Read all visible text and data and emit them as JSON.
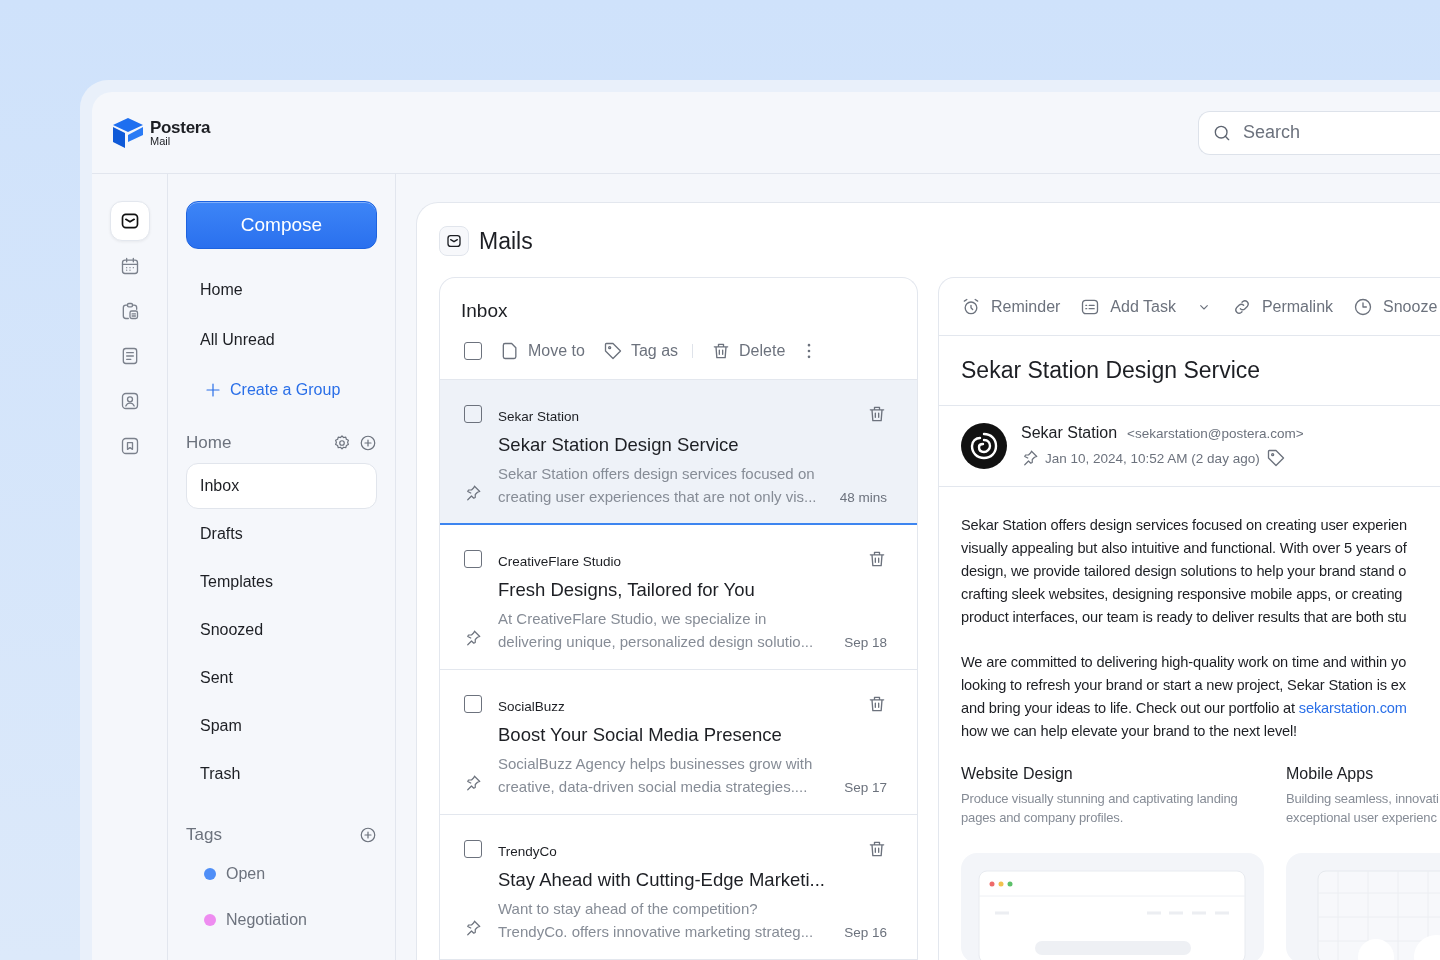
{
  "app": {
    "name": "Postera",
    "subtitle": "Mail"
  },
  "search": {
    "placeholder": "Search"
  },
  "rail": [
    {
      "selected": true
    },
    {
      "selected": false
    },
    {
      "selected": false
    },
    {
      "selected": false
    },
    {
      "selected": false
    },
    {
      "selected": false
    }
  ],
  "compose": "Compose",
  "nav": [
    {
      "label": "Home",
      "kind": "link"
    },
    {
      "label": "All Unread",
      "kind": "link"
    },
    {
      "label": "Create a Group",
      "kind": "action"
    }
  ],
  "folders_section": {
    "title": "Home",
    "items": [
      {
        "label": "Inbox",
        "selected": true
      },
      {
        "label": "Drafts",
        "selected": false
      },
      {
        "label": "Templates",
        "selected": false
      },
      {
        "label": "Snoozed",
        "selected": false
      },
      {
        "label": "Sent",
        "selected": false
      },
      {
        "label": "Spam",
        "selected": false
      },
      {
        "label": "Trash",
        "selected": false
      }
    ]
  },
  "tags_section": {
    "title": "Tags",
    "items": [
      {
        "label": "Open",
        "color": "#4f8ef7"
      },
      {
        "label": "Negotiation",
        "color": "#ee8cf0"
      }
    ]
  },
  "main": {
    "title": "Mails"
  },
  "inbox": {
    "title": "Inbox",
    "checked": false,
    "actions": [
      {
        "label": "Move to",
        "kind": "move"
      },
      {
        "label": "Tag as",
        "kind": "tag"
      },
      {
        "label": "Delete",
        "kind": "delete"
      }
    ],
    "mails": [
      {
        "sender": "Sekar Station",
        "subject": "Sekar Station Design Service",
        "preview": "Sekar Station offers design services focused on creating user experiences that are not only vis...",
        "time": "48 mins",
        "selected": true,
        "checked": false
      },
      {
        "sender": "CreativeFlare Studio",
        "subject": "Fresh Designs, Tailored for You",
        "preview": "At CreativeFlare Studio, we specialize in delivering unique, personalized design solutio...",
        "time": "Sep 18",
        "selected": false,
        "checked": false
      },
      {
        "sender": "SocialBuzz",
        "subject": "Boost Your Social Media Presence",
        "preview": "SocialBuzz Agency helps businesses grow with creative, data-driven social media strategies....",
        "time": "Sep 17",
        "selected": false,
        "checked": false
      },
      {
        "sender": "TrendyCo",
        "subject": "Stay Ahead with Cutting-Edge Marketi...",
        "preview": "Want to stay ahead of the competition? TrendyCo. offers innovative marketing strateg...",
        "time": "Sep 16",
        "selected": false,
        "checked": false
      }
    ]
  },
  "detail": {
    "actions": [
      {
        "label": "Reminder",
        "kind": "reminder"
      },
      {
        "label": "Add Task",
        "kind": "task"
      },
      {
        "label": "Permalink",
        "kind": "link"
      },
      {
        "label": "Snooze",
        "kind": "snooze"
      }
    ],
    "title": "Sekar Station Design Service",
    "sender": {
      "name": "Sekar Station",
      "email": "<sekarstation@postera.com>",
      "date": "Jan 10, 2024, 10:52 AM (2 day ago)"
    },
    "paragraphs": [
      [
        {
          "text": "Sekar Station offers design services focused on creating user experien"
        },
        {
          "text": "visually appealing but also intuitive and functional. With over 5 years of"
        },
        {
          "text": "design, we provide tailored design solutions to help your brand stand o"
        },
        {
          "text": "crafting sleek websites, designing responsive mobile apps, or creating"
        },
        {
          "text": "product interfaces, our team is ready to deliver results that are both stu"
        }
      ],
      [
        {
          "text": "We are committed to delivering high-quality work on time and within yo"
        },
        {
          "text": "looking to refresh your brand or start a new project, Sekar Station is ex"
        },
        {
          "text": "and bring your ideas to life. Check out our portfolio at ",
          "link": "sekarstation.com"
        },
        {
          "text": "how we can help elevate your brand to the next level!"
        }
      ]
    ],
    "features": [
      {
        "title": "Website Design",
        "lines": [
          "Produce visually stunning and captivating landing",
          "pages and company profiles."
        ],
        "kind": "browser"
      },
      {
        "title": "Mobile Apps",
        "lines": [
          "Building seamless, innovati",
          "exceptional user experienc"
        ],
        "kind": "grid"
      }
    ]
  }
}
